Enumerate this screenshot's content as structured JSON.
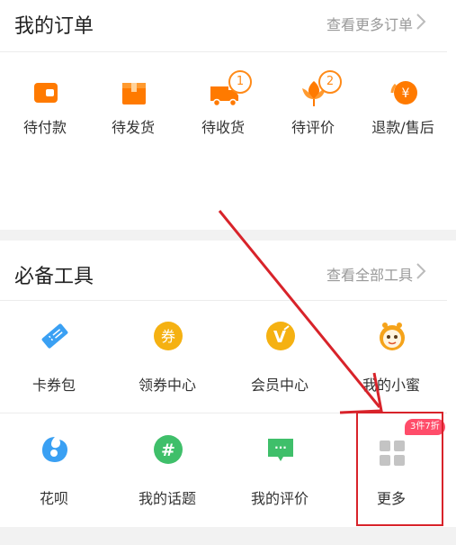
{
  "orders": {
    "title": "我的订单",
    "more_label": "查看更多订单",
    "items": [
      {
        "label": "待付款",
        "icon": "wallet-icon"
      },
      {
        "label": "待发货",
        "icon": "package-icon"
      },
      {
        "label": "待收货",
        "icon": "truck-icon",
        "count": "1"
      },
      {
        "label": "待评价",
        "icon": "flower-icon",
        "count": "2"
      },
      {
        "label": "退款/售后",
        "icon": "refund-icon"
      }
    ]
  },
  "tools": {
    "title": "必备工具",
    "more_label": "查看全部工具",
    "items": [
      {
        "label": "卡券包",
        "icon": "ticket-icon"
      },
      {
        "label": "领券中心",
        "icon": "coupon-center-icon",
        "glyph": "券"
      },
      {
        "label": "会员中心",
        "icon": "vip-icon",
        "glyph": "V"
      },
      {
        "label": "我的小蜜",
        "icon": "bee-assistant-icon"
      },
      {
        "label": "花呗",
        "icon": "huabei-icon"
      },
      {
        "label": "我的话题",
        "icon": "topic-icon",
        "glyph": "#"
      },
      {
        "label": "我的评价",
        "icon": "review-icon",
        "glyph": "···"
      },
      {
        "label": "更多",
        "icon": "grid-icon",
        "promo": "3件7折"
      }
    ]
  },
  "colors": {
    "accent_orange": "#ff7a00",
    "highlight_red": "#d8232a"
  }
}
